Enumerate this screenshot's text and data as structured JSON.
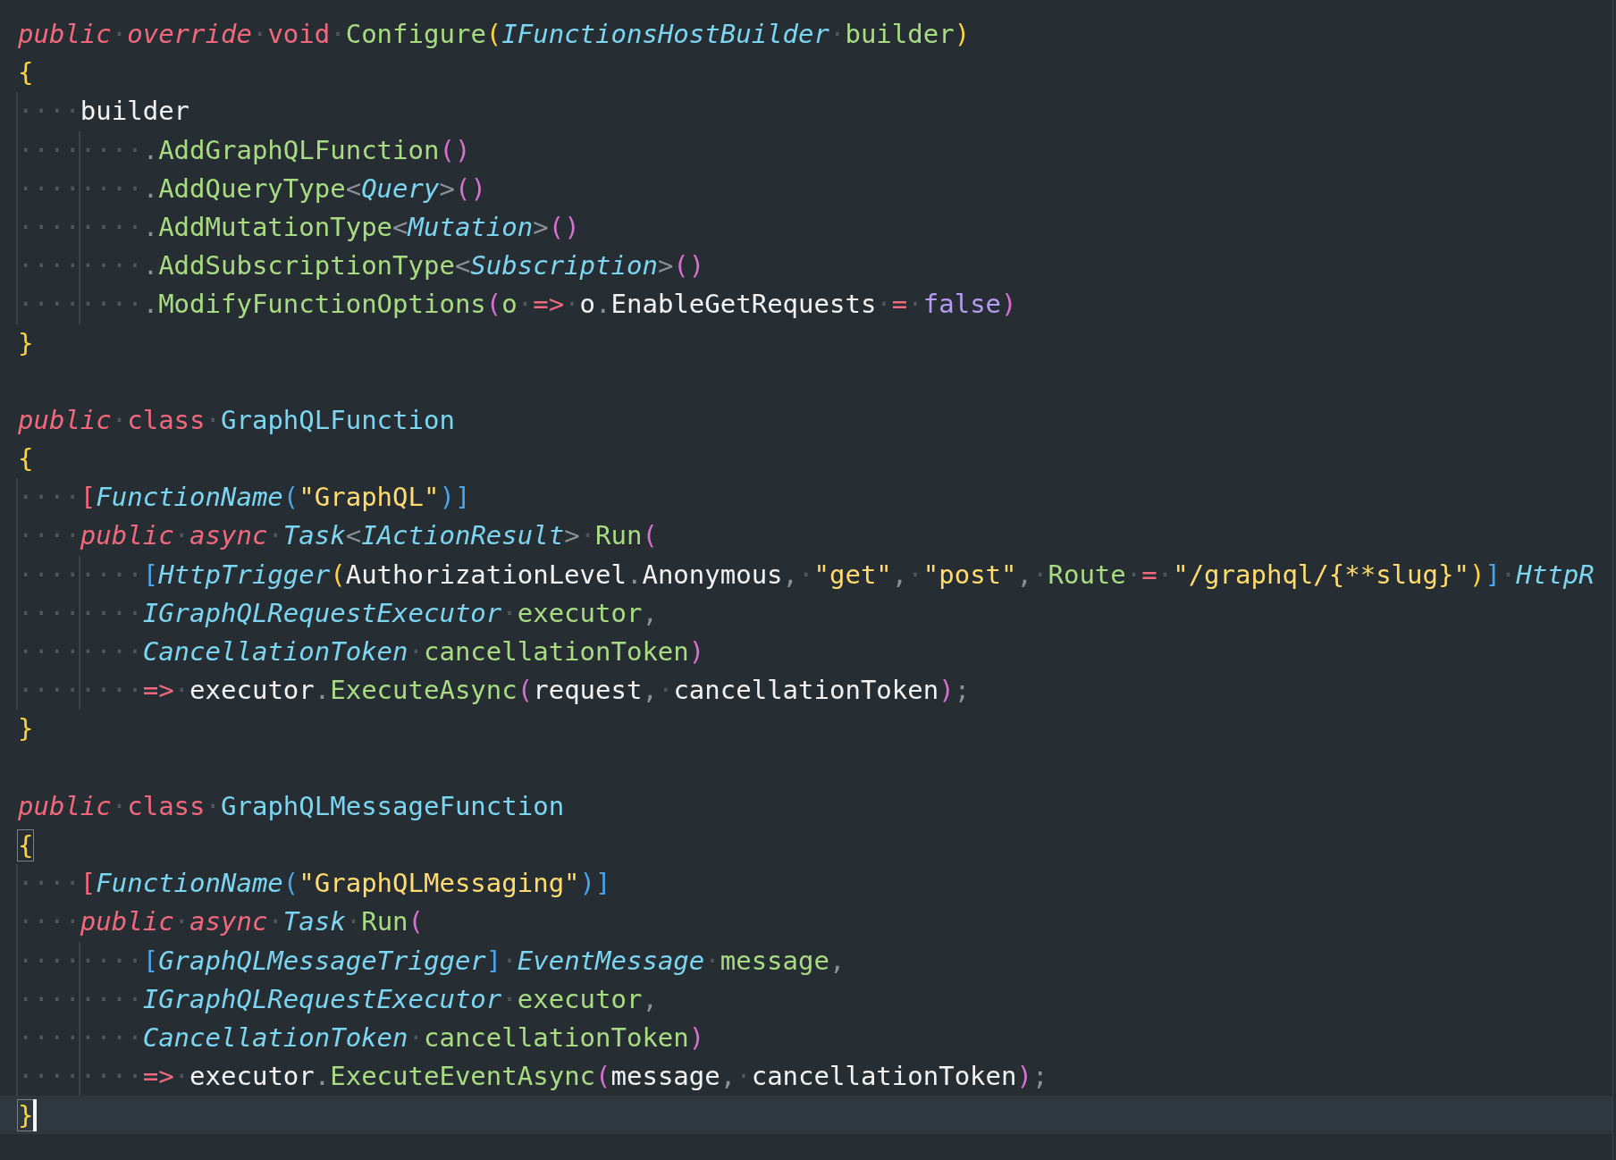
{
  "editor": {
    "blocks": [
      {
        "lines": [
          {
            "current": false,
            "tokens": [
              {
                "kind": "kw",
                "text": "public"
              },
              {
                "kind": "ws",
                "text": "·"
              },
              {
                "kind": "kw",
                "text": "override"
              },
              {
                "kind": "ws",
                "text": "·"
              },
              {
                "kind": "kwn",
                "text": "void"
              },
              {
                "kind": "ws",
                "text": "·"
              },
              {
                "kind": "fn",
                "text": "Configure"
              },
              {
                "kind": "br",
                "text": "("
              },
              {
                "kind": "ty",
                "text": "IFunctionsHostBuilder"
              },
              {
                "kind": "ws",
                "text": "·"
              },
              {
                "kind": "fn",
                "text": "builder"
              },
              {
                "kind": "br",
                "text": ")"
              }
            ]
          },
          {
            "current": false,
            "tokens": [
              {
                "kind": "br",
                "text": "{"
              }
            ]
          },
          {
            "current": false,
            "tokens": [
              {
                "kind": "indent",
                "text": "····"
              },
              {
                "kind": "id",
                "text": "builder"
              }
            ]
          },
          {
            "current": false,
            "tokens": [
              {
                "kind": "indent",
                "text": "········"
              },
              {
                "kind": "p",
                "text": "."
              },
              {
                "kind": "fn",
                "text": "AddGraphQLFunction"
              },
              {
                "kind": "pa",
                "text": "()"
              }
            ]
          },
          {
            "current": false,
            "tokens": [
              {
                "kind": "indent",
                "text": "········"
              },
              {
                "kind": "p",
                "text": "."
              },
              {
                "kind": "fn",
                "text": "AddQueryType"
              },
              {
                "kind": "p",
                "text": "<"
              },
              {
                "kind": "ty",
                "text": "Query"
              },
              {
                "kind": "p",
                "text": ">"
              },
              {
                "kind": "pa",
                "text": "()"
              }
            ]
          },
          {
            "current": false,
            "tokens": [
              {
                "kind": "indent",
                "text": "········"
              },
              {
                "kind": "p",
                "text": "."
              },
              {
                "kind": "fn",
                "text": "AddMutationType"
              },
              {
                "kind": "p",
                "text": "<"
              },
              {
                "kind": "ty",
                "text": "Mutation"
              },
              {
                "kind": "p",
                "text": ">"
              },
              {
                "kind": "pa",
                "text": "()"
              }
            ]
          },
          {
            "current": false,
            "tokens": [
              {
                "kind": "indent",
                "text": "········"
              },
              {
                "kind": "p",
                "text": "."
              },
              {
                "kind": "fn",
                "text": "AddSubscriptionType"
              },
              {
                "kind": "p",
                "text": "<"
              },
              {
                "kind": "ty",
                "text": "Subscription"
              },
              {
                "kind": "p",
                "text": ">"
              },
              {
                "kind": "pa",
                "text": "()"
              }
            ]
          },
          {
            "current": false,
            "tokens": [
              {
                "kind": "indent",
                "text": "········"
              },
              {
                "kind": "p",
                "text": "."
              },
              {
                "kind": "fn",
                "text": "ModifyFunctionOptions"
              },
              {
                "kind": "pa",
                "text": "("
              },
              {
                "kind": "fn",
                "text": "o"
              },
              {
                "kind": "ws",
                "text": "·"
              },
              {
                "kind": "op",
                "text": "=>"
              },
              {
                "kind": "ws",
                "text": "·"
              },
              {
                "kind": "id",
                "text": "o"
              },
              {
                "kind": "p",
                "text": "."
              },
              {
                "kind": "id",
                "text": "EnableGetRequests"
              },
              {
                "kind": "ws",
                "text": "·"
              },
              {
                "kind": "op",
                "text": "="
              },
              {
                "kind": "ws",
                "text": "·"
              },
              {
                "kind": "bo",
                "text": "false"
              },
              {
                "kind": "pa",
                "text": ")"
              }
            ]
          },
          {
            "current": false,
            "tokens": [
              {
                "kind": "br",
                "text": "}"
              }
            ]
          }
        ]
      },
      {
        "lines": [
          {
            "current": false,
            "tokens": [
              {
                "kind": "kw",
                "text": "public"
              },
              {
                "kind": "ws",
                "text": "·"
              },
              {
                "kind": "kwn",
                "text": "class"
              },
              {
                "kind": "ws",
                "text": "·"
              },
              {
                "kind": "cl",
                "text": "GraphQLFunction"
              }
            ]
          },
          {
            "current": false,
            "tokens": [
              {
                "kind": "br",
                "text": "{"
              }
            ]
          },
          {
            "current": false,
            "tokens": [
              {
                "kind": "indent",
                "text": "····"
              },
              {
                "kind": "op",
                "text": "["
              },
              {
                "kind": "ty",
                "text": "FunctionName"
              },
              {
                "kind": "bk",
                "text": "("
              },
              {
                "kind": "st",
                "text": "\"GraphQL\""
              },
              {
                "kind": "bk",
                "text": ")]"
              }
            ]
          },
          {
            "current": false,
            "tokens": [
              {
                "kind": "indent",
                "text": "····"
              },
              {
                "kind": "kw",
                "text": "public"
              },
              {
                "kind": "ws",
                "text": "·"
              },
              {
                "kind": "kw",
                "text": "async"
              },
              {
                "kind": "ws",
                "text": "·"
              },
              {
                "kind": "ty",
                "text": "Task"
              },
              {
                "kind": "p",
                "text": "<"
              },
              {
                "kind": "ty",
                "text": "IActionResult"
              },
              {
                "kind": "p",
                "text": ">"
              },
              {
                "kind": "ws",
                "text": "·"
              },
              {
                "kind": "fn",
                "text": "Run"
              },
              {
                "kind": "pa",
                "text": "("
              }
            ]
          },
          {
            "current": false,
            "tokens": [
              {
                "kind": "indent",
                "text": "········"
              },
              {
                "kind": "bk",
                "text": "["
              },
              {
                "kind": "ty",
                "text": "HttpTrigger"
              },
              {
                "kind": "br",
                "text": "("
              },
              {
                "kind": "id",
                "text": "AuthorizationLevel"
              },
              {
                "kind": "p",
                "text": "."
              },
              {
                "kind": "id",
                "text": "Anonymous"
              },
              {
                "kind": "p",
                "text": ","
              },
              {
                "kind": "ws",
                "text": "·"
              },
              {
                "kind": "st",
                "text": "\"get\""
              },
              {
                "kind": "p",
                "text": ","
              },
              {
                "kind": "ws",
                "text": "·"
              },
              {
                "kind": "st",
                "text": "\"post\""
              },
              {
                "kind": "p",
                "text": ","
              },
              {
                "kind": "ws",
                "text": "·"
              },
              {
                "kind": "fn",
                "text": "Route"
              },
              {
                "kind": "ws",
                "text": "·"
              },
              {
                "kind": "op",
                "text": "="
              },
              {
                "kind": "ws",
                "text": "·"
              },
              {
                "kind": "st",
                "text": "\"/graphql/{**slug}\""
              },
              {
                "kind": "br",
                "text": ")"
              },
              {
                "kind": "bk",
                "text": "]"
              },
              {
                "kind": "ws",
                "text": "·"
              },
              {
                "kind": "ty",
                "text": "HttpR"
              }
            ]
          },
          {
            "current": false,
            "tokens": [
              {
                "kind": "indent",
                "text": "········"
              },
              {
                "kind": "ty",
                "text": "IGraphQLRequestExecutor"
              },
              {
                "kind": "ws",
                "text": "·"
              },
              {
                "kind": "fn",
                "text": "executor"
              },
              {
                "kind": "p",
                "text": ","
              }
            ]
          },
          {
            "current": false,
            "tokens": [
              {
                "kind": "indent",
                "text": "········"
              },
              {
                "kind": "ty",
                "text": "CancellationToken"
              },
              {
                "kind": "ws",
                "text": "·"
              },
              {
                "kind": "fn",
                "text": "cancellationToken"
              },
              {
                "kind": "pa",
                "text": ")"
              }
            ]
          },
          {
            "current": false,
            "tokens": [
              {
                "kind": "indent",
                "text": "········"
              },
              {
                "kind": "op",
                "text": "=>"
              },
              {
                "kind": "ws",
                "text": "·"
              },
              {
                "kind": "id",
                "text": "executor"
              },
              {
                "kind": "p",
                "text": "."
              },
              {
                "kind": "fn",
                "text": "ExecuteAsync"
              },
              {
                "kind": "pa",
                "text": "("
              },
              {
                "kind": "id",
                "text": "request"
              },
              {
                "kind": "p",
                "text": ","
              },
              {
                "kind": "ws",
                "text": "·"
              },
              {
                "kind": "id",
                "text": "cancellationToken"
              },
              {
                "kind": "pa",
                "text": ")"
              },
              {
                "kind": "p",
                "text": ";"
              }
            ]
          },
          {
            "current": false,
            "tokens": [
              {
                "kind": "br",
                "text": "}"
              }
            ]
          }
        ]
      },
      {
        "lines": [
          {
            "current": false,
            "tokens": [
              {
                "kind": "kw",
                "text": "public"
              },
              {
                "kind": "ws",
                "text": "·"
              },
              {
                "kind": "kwn",
                "text": "class"
              },
              {
                "kind": "ws",
                "text": "·"
              },
              {
                "kind": "cl",
                "text": "GraphQLMessageFunction"
              }
            ]
          },
          {
            "current": false,
            "tokens": [
              {
                "kind": "br",
                "text": "{",
                "highlighted": true
              }
            ]
          },
          {
            "current": false,
            "tokens": [
              {
                "kind": "indent",
                "text": "····"
              },
              {
                "kind": "op",
                "text": "["
              },
              {
                "kind": "ty",
                "text": "FunctionName"
              },
              {
                "kind": "bk",
                "text": "("
              },
              {
                "kind": "st",
                "text": "\"GraphQLMessaging\""
              },
              {
                "kind": "bk",
                "text": ")]"
              }
            ]
          },
          {
            "current": false,
            "tokens": [
              {
                "kind": "indent",
                "text": "····"
              },
              {
                "kind": "kw",
                "text": "public"
              },
              {
                "kind": "ws",
                "text": "·"
              },
              {
                "kind": "kw",
                "text": "async"
              },
              {
                "kind": "ws",
                "text": "·"
              },
              {
                "kind": "ty",
                "text": "Task"
              },
              {
                "kind": "ws",
                "text": "·"
              },
              {
                "kind": "fn",
                "text": "Run"
              },
              {
                "kind": "pa",
                "text": "("
              }
            ]
          },
          {
            "current": false,
            "tokens": [
              {
                "kind": "indent",
                "text": "········"
              },
              {
                "kind": "bk",
                "text": "["
              },
              {
                "kind": "ty",
                "text": "GraphQLMessageTrigger"
              },
              {
                "kind": "bk",
                "text": "]"
              },
              {
                "kind": "ws",
                "text": "·"
              },
              {
                "kind": "ty",
                "text": "EventMessage"
              },
              {
                "kind": "ws",
                "text": "·"
              },
              {
                "kind": "fn",
                "text": "message"
              },
              {
                "kind": "p",
                "text": ","
              }
            ]
          },
          {
            "current": false,
            "tokens": [
              {
                "kind": "indent",
                "text": "········"
              },
              {
                "kind": "ty",
                "text": "IGraphQLRequestExecutor"
              },
              {
                "kind": "ws",
                "text": "·"
              },
              {
                "kind": "fn",
                "text": "executor"
              },
              {
                "kind": "p",
                "text": ","
              }
            ]
          },
          {
            "current": false,
            "tokens": [
              {
                "kind": "indent",
                "text": "········"
              },
              {
                "kind": "ty",
                "text": "CancellationToken"
              },
              {
                "kind": "ws",
                "text": "·"
              },
              {
                "kind": "fn",
                "text": "cancellationToken"
              },
              {
                "kind": "pa",
                "text": ")"
              }
            ]
          },
          {
            "current": false,
            "tokens": [
              {
                "kind": "indent",
                "text": "········"
              },
              {
                "kind": "op",
                "text": "=>"
              },
              {
                "kind": "ws",
                "text": "·"
              },
              {
                "kind": "id",
                "text": "executor"
              },
              {
                "kind": "p",
                "text": "."
              },
              {
                "kind": "fn",
                "text": "ExecuteEventAsync"
              },
              {
                "kind": "pa",
                "text": "("
              },
              {
                "kind": "id",
                "text": "message"
              },
              {
                "kind": "p",
                "text": ","
              },
              {
                "kind": "ws",
                "text": "·"
              },
              {
                "kind": "id",
                "text": "cancellationToken"
              },
              {
                "kind": "pa",
                "text": ")"
              },
              {
                "kind": "p",
                "text": ";"
              }
            ]
          },
          {
            "current": true,
            "tokens": [
              {
                "kind": "br",
                "text": "}",
                "highlighted": true
              }
            ]
          }
        ]
      }
    ]
  }
}
